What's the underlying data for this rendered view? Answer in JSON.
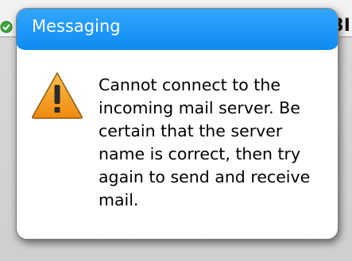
{
  "background": {
    "partial_text": "3I",
    "status_icon": "green-check-icon"
  },
  "dialog": {
    "title": "Messaging",
    "icon": "warning-icon",
    "message": "Cannot connect to the incoming mail server. Be certain that the server name is correct, then try again to send and receive mail."
  },
  "colors": {
    "titlebar": "#1a94f5",
    "warning_fill": "#f7a21b",
    "warning_mark": "#2b2b2b"
  }
}
